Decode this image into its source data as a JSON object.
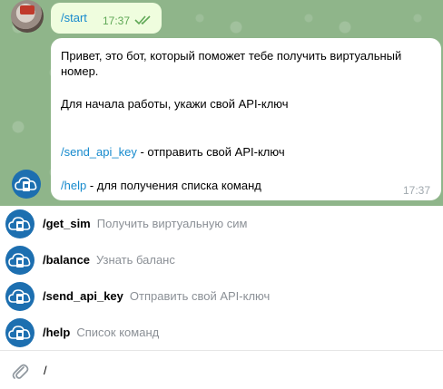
{
  "chat": {
    "outgoing": {
      "command": "/start",
      "time": "17:37",
      "status_icon": "double-check-icon"
    },
    "incoming": {
      "line1": "Привет, это бот, который поможет тебе получить виртуальный",
      "line2": "номер.",
      "line3": "Для начала работы, укажи свой API-ключ",
      "cmd1": "/send_api_key",
      "cmd1_desc": " - отправить свой API-ключ",
      "cmd2": "/help",
      "cmd2_desc": " - для получения списка команд",
      "time": "17:37"
    }
  },
  "commands": [
    {
      "name": "/get_sim",
      "desc": "Получить виртуальную сим"
    },
    {
      "name": "/balance",
      "desc": "Узнать баланс"
    },
    {
      "name": "/send_api_key",
      "desc": "Отправить свой API-ключ"
    },
    {
      "name": "/help",
      "desc": "Список команд"
    }
  ],
  "input": {
    "value": "/",
    "attach_icon": "paperclip-icon"
  },
  "colors": {
    "chat_background": "#8fb58a",
    "outgoing_bubble": "#effdde",
    "link": "#168acd",
    "bot_avatar": "#1d6fb0"
  }
}
